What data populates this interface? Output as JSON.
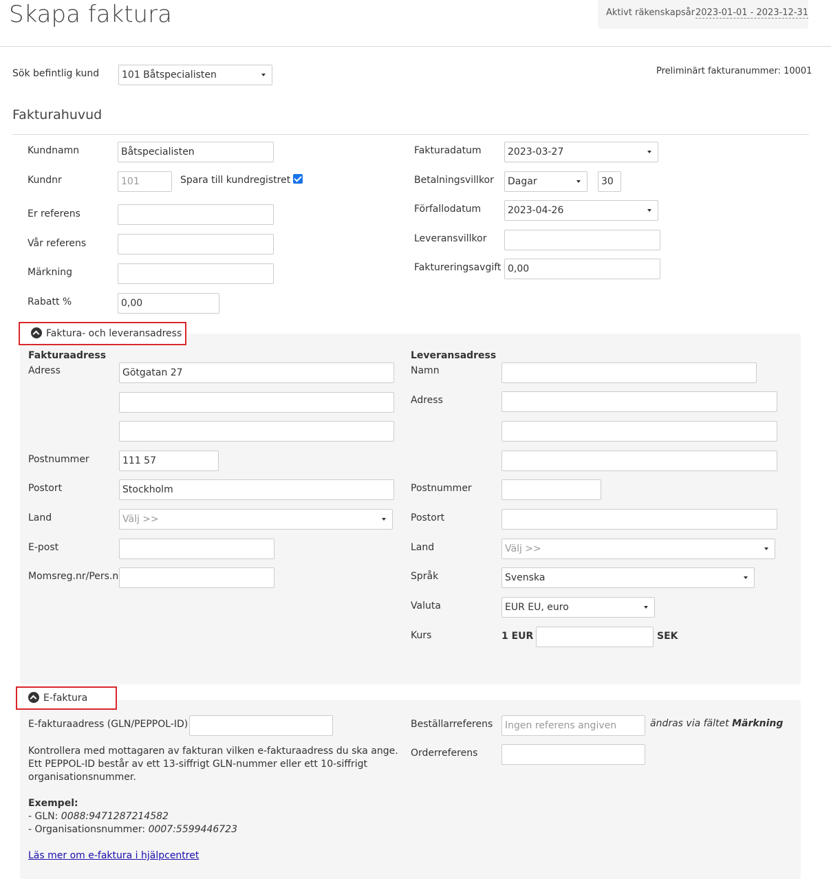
{
  "page": {
    "title": "Skapa faktura",
    "fiscal_year_label": "Aktivt räkenskapsår",
    "fiscal_year_value": "2023-01-01 - 2023-12-31"
  },
  "search": {
    "label": "Sök befintlig kund",
    "selected": "101 Båtspecialisten",
    "preliminary_invoice_number": "Preliminärt fakturanummer: 10001"
  },
  "header_section": {
    "title": "Fakturahuvud",
    "customer_name_label": "Kundnamn",
    "customer_name_value": "Båtspecialisten",
    "customer_no_label": "Kundnr",
    "customer_no_value": "101",
    "save_to_register_label": "Spara till kundregistret",
    "your_reference_label": "Er referens",
    "our_reference_label": "Vår referens",
    "marking_label": "Märkning",
    "discount_label": "Rabatt %",
    "discount_value": "0,00",
    "invoice_date_label": "Fakturadatum",
    "invoice_date_value": "2023-03-27",
    "payment_terms_label": "Betalningsvillkor",
    "payment_terms_value": "Dagar",
    "payment_terms_days": "30",
    "due_date_label": "Förfallodatum",
    "due_date_value": "2023-04-26",
    "delivery_terms_label": "Leveransvillkor",
    "invoicing_fee_label": "Faktureringsavgift",
    "invoicing_fee_value": "0,00"
  },
  "address_section": {
    "toggle_label": "Faktura- och leveransadress",
    "billing": {
      "title": "Fakturaadress",
      "address_label": "Adress",
      "address_line1": "Götgatan 27",
      "postal_code_label": "Postnummer",
      "postal_code_value": "111 57",
      "city_label": "Postort",
      "city_value": "Stockholm",
      "country_label": "Land",
      "country_placeholder": "Välj >>",
      "email_label": "E-post",
      "vat_label": "Momsreg.nr/Pers.nr"
    },
    "delivery": {
      "title": "Leveransadress",
      "name_label": "Namn",
      "address_label": "Adress",
      "postal_code_label": "Postnummer",
      "city_label": "Postort",
      "country_label": "Land",
      "country_placeholder": "Välj >>",
      "language_label": "Språk",
      "language_value": "Svenska",
      "currency_label": "Valuta",
      "currency_value": "EUR EU, euro",
      "rate_label": "Kurs",
      "rate_prefix": "1 EUR =",
      "rate_suffix": "SEK"
    }
  },
  "efaktura_section": {
    "toggle_label": "E-faktura",
    "address_label": "E-fakturaadress (GLN/PEPPOL-ID)",
    "info_line1": "Kontrollera med mottagaren av fakturan vilken e-fakturaadress du ska ange.",
    "info_line2": "Ett PEPPOL-ID består av ett 13-siffrigt GLN-nummer eller ett 10-siffrigt",
    "info_line3": "organisationsnummer.",
    "example_title": "Exempel:",
    "example_gln_prefix": "- GLN: ",
    "example_gln_value": "0088:9471287214582",
    "example_org_prefix": "- Organisationsnummer: ",
    "example_org_value": "0007:5599446723",
    "help_link": "Läs mer om e-faktura i hjälpcentret",
    "orderer_ref_label": "Beställarreferens",
    "orderer_ref_placeholder": "Ingen referens angiven",
    "orderer_ref_note_prefix": "ändras via fältet ",
    "orderer_ref_note_field": "Märkning",
    "order_ref_label": "Orderreferens"
  },
  "colors": {
    "highlight_border": "#d9262b",
    "checkbox": "#1a73e8",
    "panel_bg": "#f5f5f5"
  }
}
